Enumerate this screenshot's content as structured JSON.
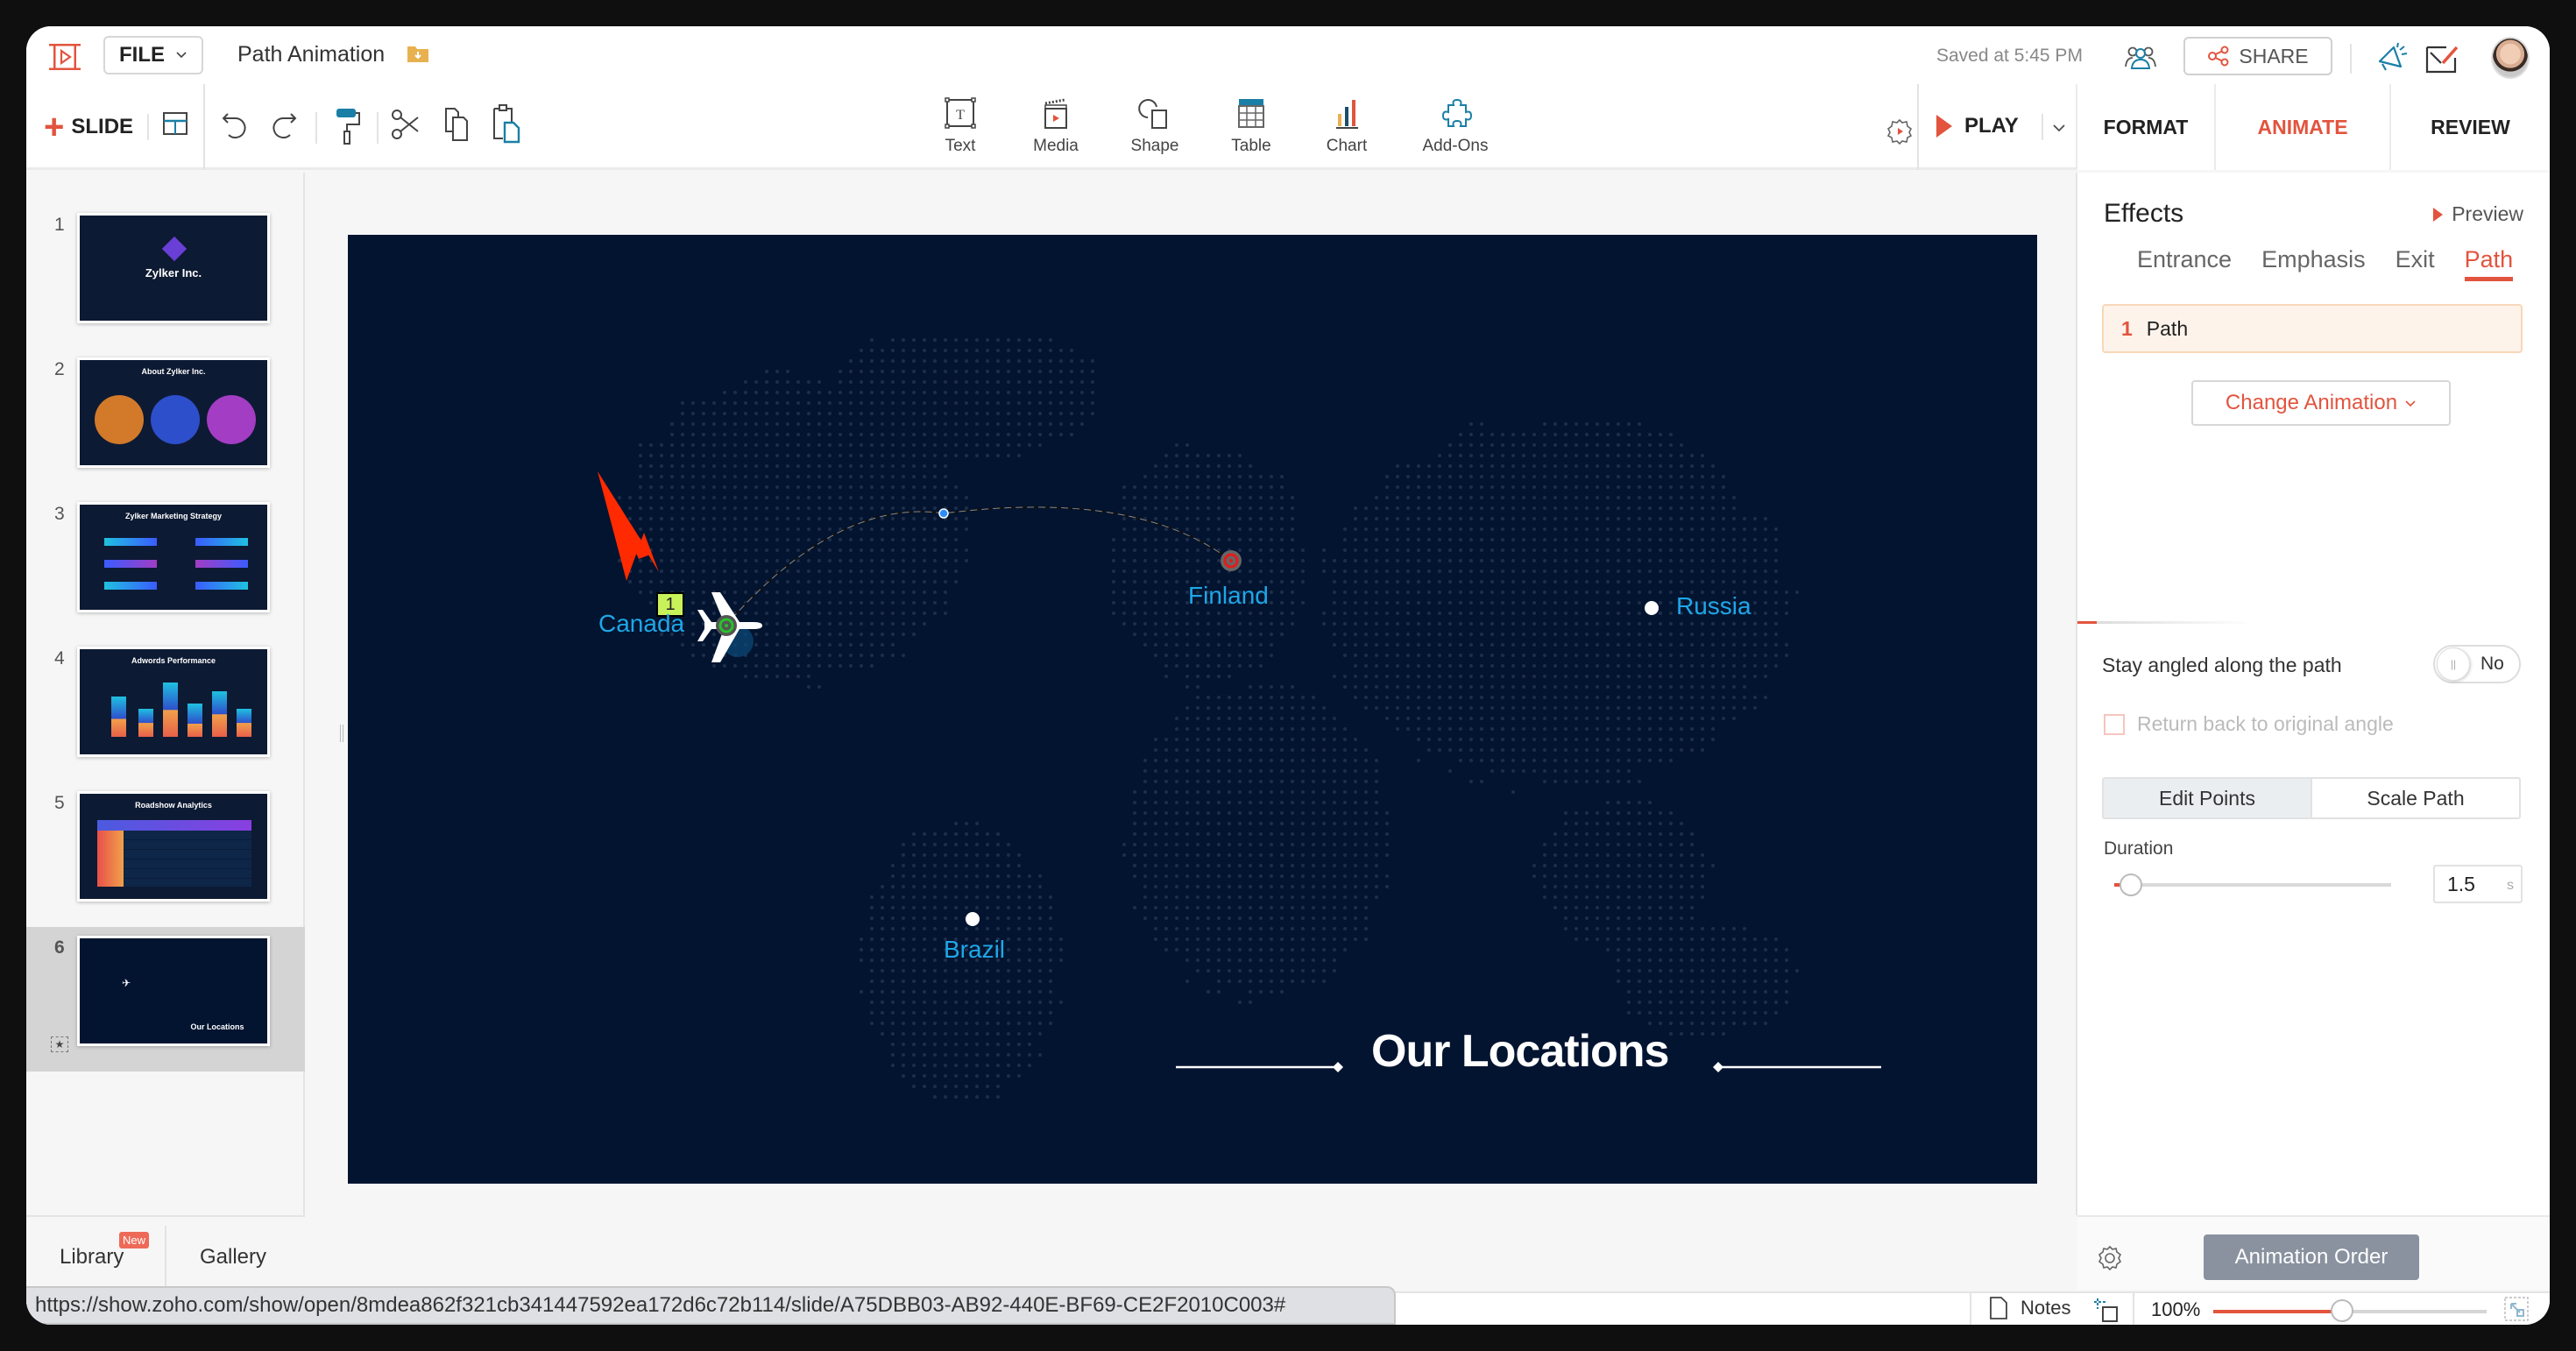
{
  "header": {
    "file_label": "FILE",
    "document_title": "Path Animation",
    "saved_status": "Saved at 5:45 PM",
    "share_label": "SHARE"
  },
  "toolbar": {
    "add_slide_label": "SLIDE",
    "insert_items": [
      {
        "label": "Text",
        "icon": "text-box-icon"
      },
      {
        "label": "Media",
        "icon": "clapperboard-icon"
      },
      {
        "label": "Shape",
        "icon": "shape-icon"
      },
      {
        "label": "Table",
        "icon": "table-icon"
      },
      {
        "label": "Chart",
        "icon": "bar-chart-icon"
      },
      {
        "label": "Add-Ons",
        "icon": "puzzle-icon"
      }
    ],
    "play_label": "PLAY"
  },
  "panel_tabs": [
    {
      "label": "FORMAT",
      "active": false
    },
    {
      "label": "ANIMATE",
      "active": true
    },
    {
      "label": "REVIEW",
      "active": false
    }
  ],
  "slides": [
    {
      "number": "1",
      "title": "Zylker Inc."
    },
    {
      "number": "2",
      "title": "About Zylker Inc."
    },
    {
      "number": "3",
      "title": "Zylker Marketing Strategy"
    },
    {
      "number": "4",
      "title": "Adwords Performance"
    },
    {
      "number": "5",
      "title": "Roadshow Analytics"
    },
    {
      "number": "6",
      "title": "Our Locations",
      "active": true
    }
  ],
  "library": {
    "library_label": "Library",
    "new_badge": "New",
    "gallery_label": "Gallery"
  },
  "slide_content": {
    "heading": "Our Locations",
    "locations": [
      "Canada",
      "Finland",
      "Russia",
      "Brazil"
    ],
    "animation_step": "1"
  },
  "animate_panel": {
    "effects_title": "Effects",
    "preview_label": "Preview",
    "effect_tabs": [
      {
        "label": "Entrance",
        "active": false
      },
      {
        "label": "Emphasis",
        "active": false
      },
      {
        "label": "Exit",
        "active": false
      },
      {
        "label": "Path",
        "active": true
      }
    ],
    "animation_list": [
      {
        "number": "1",
        "name": "Path"
      }
    ],
    "change_animation_label": "Change Animation",
    "stay_angled_label": "Stay angled along the path",
    "stay_angled_value": "No",
    "return_angle_label": "Return back to original angle",
    "return_angle_checked": false,
    "edit_points_label": "Edit Points",
    "scale_path_label": "Scale Path",
    "duration_label": "Duration",
    "duration_value": "1.5",
    "duration_unit": "s",
    "duration_slider_fraction": 0.06,
    "animation_order_label": "Animation Order"
  },
  "statusbar": {
    "url": "https://show.zoho.com/show/open/8mdea862f321cb341447592ea172d6c72b114/slide/A75DBB03-AB92-440E-BF69-CE2F2010C003#",
    "notes_label": "Notes",
    "zoom_level": "100%",
    "zoom_slider_fraction": 0.47
  },
  "colors": {
    "accent": "#e2543e",
    "slide_bg": "#021430",
    "location_label": "#1ea7e8"
  }
}
